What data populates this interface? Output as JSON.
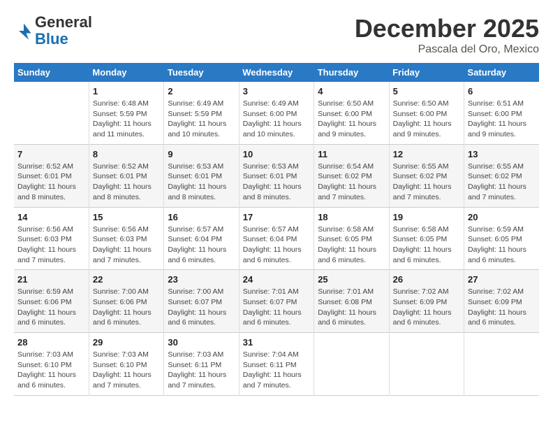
{
  "header": {
    "logo_line1": "General",
    "logo_line2": "Blue",
    "month": "December 2025",
    "location": "Pascala del Oro, Mexico"
  },
  "weekdays": [
    "Sunday",
    "Monday",
    "Tuesday",
    "Wednesday",
    "Thursday",
    "Friday",
    "Saturday"
  ],
  "weeks": [
    [
      {
        "day": "",
        "info": ""
      },
      {
        "day": "1",
        "info": "Sunrise: 6:48 AM\nSunset: 5:59 PM\nDaylight: 11 hours\nand 11 minutes."
      },
      {
        "day": "2",
        "info": "Sunrise: 6:49 AM\nSunset: 5:59 PM\nDaylight: 11 hours\nand 10 minutes."
      },
      {
        "day": "3",
        "info": "Sunrise: 6:49 AM\nSunset: 6:00 PM\nDaylight: 11 hours\nand 10 minutes."
      },
      {
        "day": "4",
        "info": "Sunrise: 6:50 AM\nSunset: 6:00 PM\nDaylight: 11 hours\nand 9 minutes."
      },
      {
        "day": "5",
        "info": "Sunrise: 6:50 AM\nSunset: 6:00 PM\nDaylight: 11 hours\nand 9 minutes."
      },
      {
        "day": "6",
        "info": "Sunrise: 6:51 AM\nSunset: 6:00 PM\nDaylight: 11 hours\nand 9 minutes."
      }
    ],
    [
      {
        "day": "7",
        "info": "Sunrise: 6:52 AM\nSunset: 6:01 PM\nDaylight: 11 hours\nand 8 minutes."
      },
      {
        "day": "8",
        "info": "Sunrise: 6:52 AM\nSunset: 6:01 PM\nDaylight: 11 hours\nand 8 minutes."
      },
      {
        "day": "9",
        "info": "Sunrise: 6:53 AM\nSunset: 6:01 PM\nDaylight: 11 hours\nand 8 minutes."
      },
      {
        "day": "10",
        "info": "Sunrise: 6:53 AM\nSunset: 6:01 PM\nDaylight: 11 hours\nand 8 minutes."
      },
      {
        "day": "11",
        "info": "Sunrise: 6:54 AM\nSunset: 6:02 PM\nDaylight: 11 hours\nand 7 minutes."
      },
      {
        "day": "12",
        "info": "Sunrise: 6:55 AM\nSunset: 6:02 PM\nDaylight: 11 hours\nand 7 minutes."
      },
      {
        "day": "13",
        "info": "Sunrise: 6:55 AM\nSunset: 6:02 PM\nDaylight: 11 hours\nand 7 minutes."
      }
    ],
    [
      {
        "day": "14",
        "info": "Sunrise: 6:56 AM\nSunset: 6:03 PM\nDaylight: 11 hours\nand 7 minutes."
      },
      {
        "day": "15",
        "info": "Sunrise: 6:56 AM\nSunset: 6:03 PM\nDaylight: 11 hours\nand 7 minutes."
      },
      {
        "day": "16",
        "info": "Sunrise: 6:57 AM\nSunset: 6:04 PM\nDaylight: 11 hours\nand 6 minutes."
      },
      {
        "day": "17",
        "info": "Sunrise: 6:57 AM\nSunset: 6:04 PM\nDaylight: 11 hours\nand 6 minutes."
      },
      {
        "day": "18",
        "info": "Sunrise: 6:58 AM\nSunset: 6:05 PM\nDaylight: 11 hours\nand 6 minutes."
      },
      {
        "day": "19",
        "info": "Sunrise: 6:58 AM\nSunset: 6:05 PM\nDaylight: 11 hours\nand 6 minutes."
      },
      {
        "day": "20",
        "info": "Sunrise: 6:59 AM\nSunset: 6:05 PM\nDaylight: 11 hours\nand 6 minutes."
      }
    ],
    [
      {
        "day": "21",
        "info": "Sunrise: 6:59 AM\nSunset: 6:06 PM\nDaylight: 11 hours\nand 6 minutes."
      },
      {
        "day": "22",
        "info": "Sunrise: 7:00 AM\nSunset: 6:06 PM\nDaylight: 11 hours\nand 6 minutes."
      },
      {
        "day": "23",
        "info": "Sunrise: 7:00 AM\nSunset: 6:07 PM\nDaylight: 11 hours\nand 6 minutes."
      },
      {
        "day": "24",
        "info": "Sunrise: 7:01 AM\nSunset: 6:07 PM\nDaylight: 11 hours\nand 6 minutes."
      },
      {
        "day": "25",
        "info": "Sunrise: 7:01 AM\nSunset: 6:08 PM\nDaylight: 11 hours\nand 6 minutes."
      },
      {
        "day": "26",
        "info": "Sunrise: 7:02 AM\nSunset: 6:09 PM\nDaylight: 11 hours\nand 6 minutes."
      },
      {
        "day": "27",
        "info": "Sunrise: 7:02 AM\nSunset: 6:09 PM\nDaylight: 11 hours\nand 6 minutes."
      }
    ],
    [
      {
        "day": "28",
        "info": "Sunrise: 7:03 AM\nSunset: 6:10 PM\nDaylight: 11 hours\nand 6 minutes."
      },
      {
        "day": "29",
        "info": "Sunrise: 7:03 AM\nSunset: 6:10 PM\nDaylight: 11 hours\nand 7 minutes."
      },
      {
        "day": "30",
        "info": "Sunrise: 7:03 AM\nSunset: 6:11 PM\nDaylight: 11 hours\nand 7 minutes."
      },
      {
        "day": "31",
        "info": "Sunrise: 7:04 AM\nSunset: 6:11 PM\nDaylight: 11 hours\nand 7 minutes."
      },
      {
        "day": "",
        "info": ""
      },
      {
        "day": "",
        "info": ""
      },
      {
        "day": "",
        "info": ""
      }
    ]
  ]
}
